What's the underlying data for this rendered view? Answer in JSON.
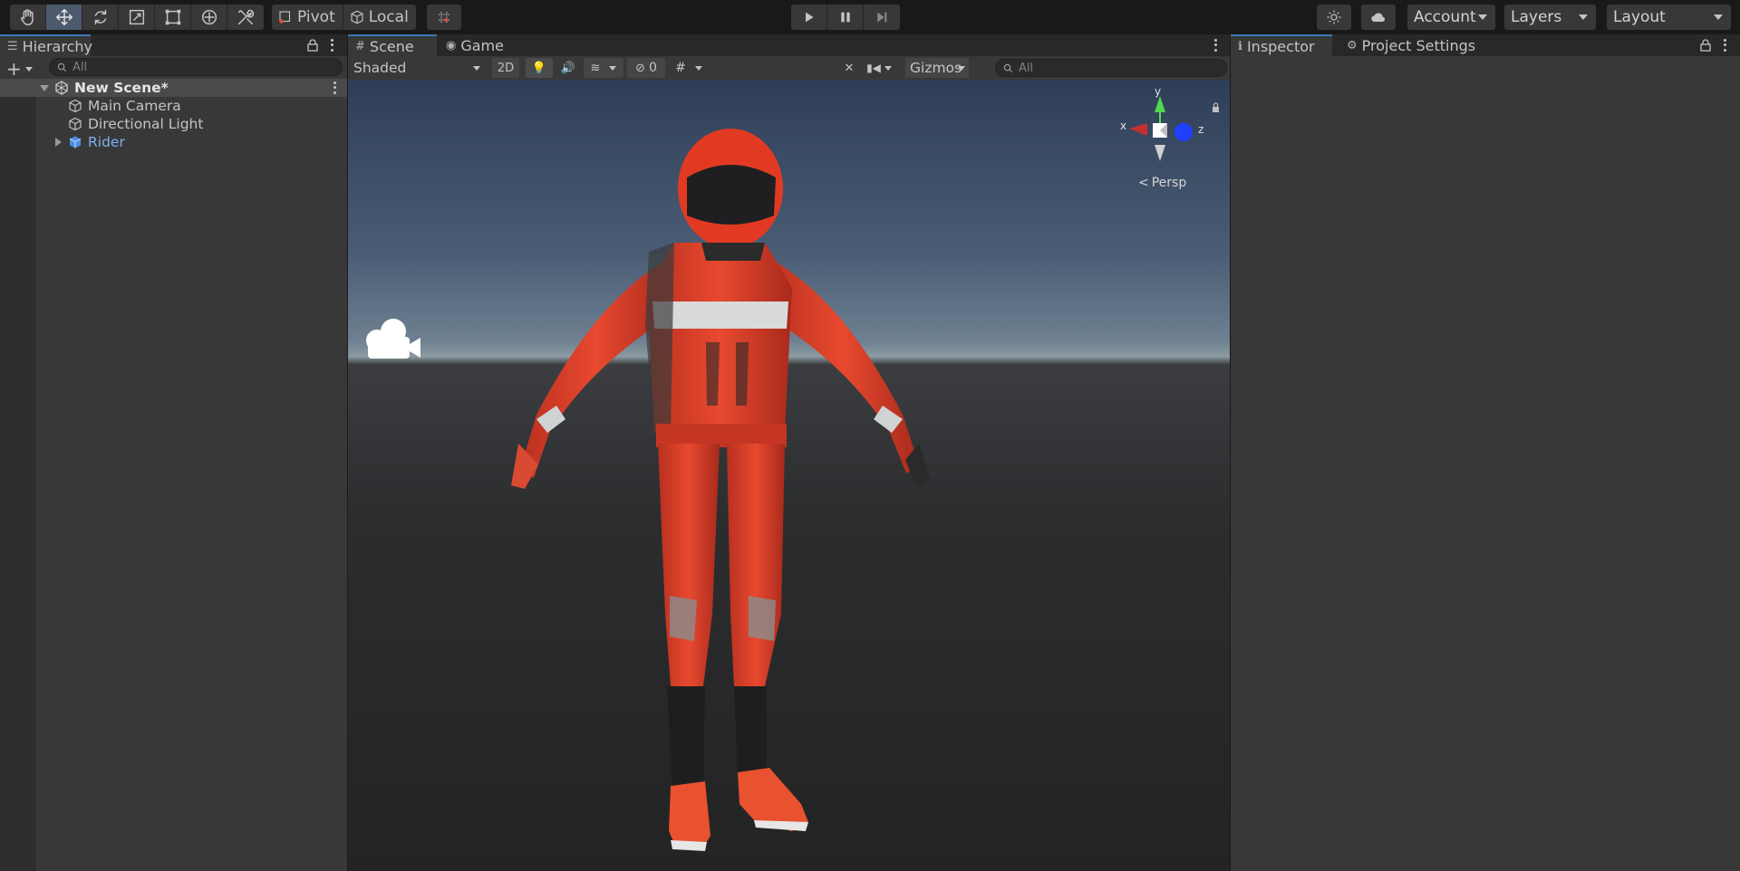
{
  "toolbar": {
    "tools": [
      "hand-tool",
      "move-tool",
      "rotate-tool",
      "scale-tool",
      "rect-tool",
      "transform-tool",
      "custom-tool"
    ],
    "active_tool": "move-tool",
    "pivot_label": "Pivot",
    "local_label": "Local",
    "account_label": "Account",
    "layers_label": "Layers",
    "layout_label": "Layout"
  },
  "hierarchy": {
    "tab_label": "Hierarchy",
    "search_placeholder": "All",
    "scene_name": "New Scene*",
    "items": [
      {
        "label": "Main Camera",
        "icon": "cube-outline-icon"
      },
      {
        "label": "Directional Light",
        "icon": "cube-outline-icon"
      },
      {
        "label": "Rider",
        "icon": "prefab-cube-icon"
      }
    ]
  },
  "scene_view": {
    "tabs": [
      {
        "label": "Scene"
      },
      {
        "label": "Game"
      }
    ],
    "active_tab": "Scene",
    "shading_mode": "Shaded",
    "two_d_label": "2D",
    "hidden_count": "0",
    "gizmos_label": "Gizmos",
    "search_placeholder": "All",
    "projection_label": "Persp",
    "axis_labels": {
      "x": "x",
      "y": "y",
      "z": "z"
    }
  },
  "inspector": {
    "tabs": [
      {
        "label": "Inspector"
      },
      {
        "label": "Project Settings"
      }
    ],
    "active_tab": "Inspector"
  },
  "colors": {
    "accent": "#3a79bb",
    "suit_red": "#e0412a",
    "link_blue": "#7cb1f0"
  }
}
